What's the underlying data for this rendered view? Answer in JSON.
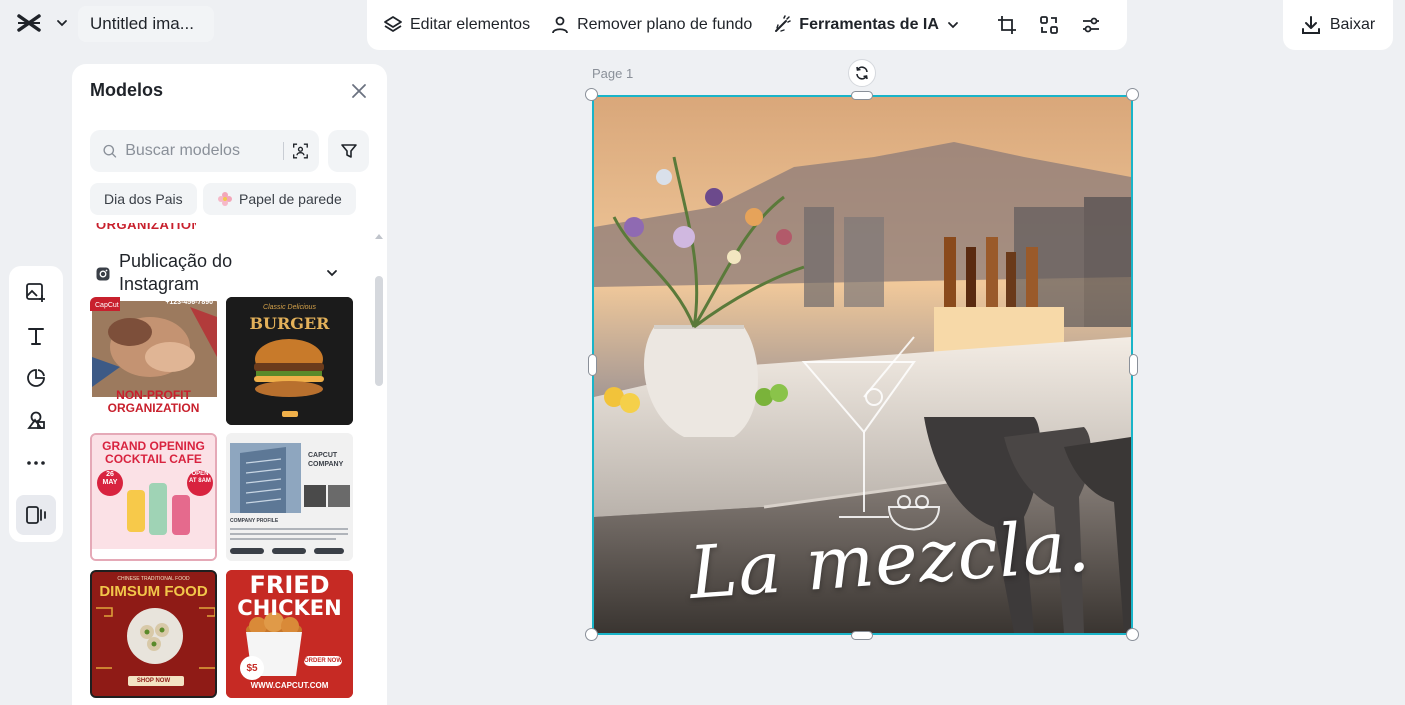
{
  "header": {
    "doc_title": "Untitled ima...",
    "toolbar": {
      "edit_elements": "Editar elementos",
      "remove_bg": "Remover plano de fundo",
      "ai_tools": "Ferramentas de IA"
    },
    "download": "Baixar"
  },
  "panel": {
    "title": "Modelos",
    "search_placeholder": "Buscar modelos",
    "chips": [
      "Dia dos Pais",
      "Papel de parede"
    ],
    "section_title": "Publicação do Instagram",
    "templates": [
      {
        "name": "Non-profit organization",
        "lines": [
          "NON-PROFIT",
          "ORGANIZATION"
        ],
        "phone": "+123-456-7890"
      },
      {
        "name": "Burger",
        "lines": [
          "Classic Delicious",
          "BURGER"
        ]
      },
      {
        "name": "Grand opening cocktail cafe",
        "lines": [
          "GRAND OPENING",
          "COCKTAIL CAFE"
        ],
        "date": "26 MAY",
        "badge": "OPEN AT 8AM"
      },
      {
        "name": "CapCut company",
        "lines": [
          "CAPCUT",
          "COMPANY"
        ],
        "caption": "COMPANY PROFILE"
      },
      {
        "name": "Dimsum food",
        "lines": [
          "CHINESE TRADITIONAL FOOD",
          "DIMSUM FOOD"
        ],
        "button": "SHOP NOW"
      },
      {
        "name": "Fried chicken",
        "lines": [
          "FRIED",
          "CHICKEN"
        ],
        "price": "$5",
        "button": "ORDER NOW",
        "url": "WWW.CAPCUT.COM"
      }
    ]
  },
  "canvas": {
    "page_label": "Page 1",
    "text": "La mezcla."
  },
  "colors": {
    "selection": "#19b4c8",
    "accent_red": "#c8202d"
  }
}
